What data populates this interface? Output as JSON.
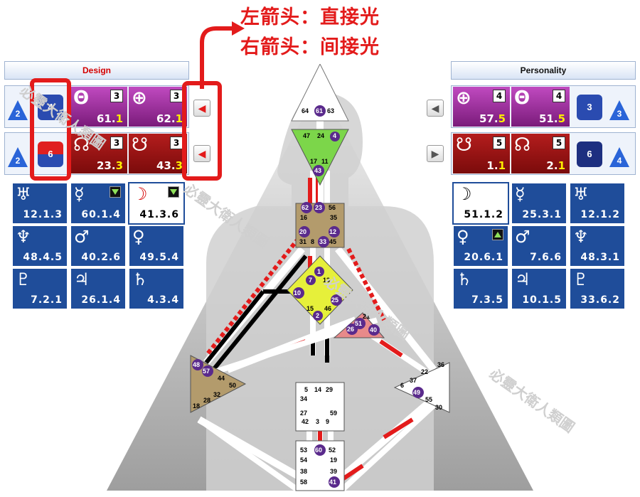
{
  "annotation": {
    "line1": "左箭头：直接光",
    "line2": "右箭头：间接光"
  },
  "design": {
    "header": "Design",
    "row1": {
      "hex_triangle": "2",
      "hex_octagon": "4",
      "planets": [
        {
          "glyph": "Θ",
          "box": "3",
          "value": "61.",
          "line": "1"
        },
        {
          "glyph": "⊕",
          "box": "3",
          "value": "62.",
          "line": "1"
        }
      ]
    },
    "row2": {
      "hex_triangle": "2",
      "hex_octagon": "6",
      "planets": [
        {
          "glyph": "☊",
          "box": "3",
          "value": "23.",
          "line": "3"
        },
        {
          "glyph": "☋",
          "box": "3",
          "value": "43.",
          "line": "3"
        }
      ]
    },
    "grid": [
      {
        "glyph": "♅",
        "value": "12.1.3"
      },
      {
        "glyph": "☿",
        "value": "60.1.4"
      },
      {
        "glyph": "☽",
        "value": "41.3.6"
      },
      {
        "glyph": "♆",
        "value": "48.4.5"
      },
      {
        "glyph": "♂",
        "value": "40.2.6"
      },
      {
        "glyph": "♀",
        "value": "49.5.4"
      },
      {
        "glyph": "♇",
        "value": "7.2.1"
      },
      {
        "glyph": "♃",
        "value": "26.1.4"
      },
      {
        "glyph": "♄",
        "value": "4.3.4"
      }
    ]
  },
  "personality": {
    "header": "Personality",
    "row1": {
      "planets": [
        {
          "glyph": "⊕",
          "box": "4",
          "value": "57.",
          "line": "5"
        },
        {
          "glyph": "Θ",
          "box": "4",
          "value": "51.",
          "line": "5"
        }
      ],
      "hex_octagon": "3",
      "hex_triangle": "3"
    },
    "row2": {
      "planets": [
        {
          "glyph": "☋",
          "box": "5",
          "value": "1.",
          "line": "1"
        },
        {
          "glyph": "☊",
          "box": "5",
          "value": "2.",
          "line": "1"
        }
      ],
      "hex_octagon": "6",
      "hex_triangle": "4"
    },
    "grid": [
      {
        "glyph": "☽",
        "value": "51.1.2"
      },
      {
        "glyph": "☿",
        "value": "25.3.1"
      },
      {
        "glyph": "♅",
        "value": "12.1.2"
      },
      {
        "glyph": "♀",
        "value": "20.6.1"
      },
      {
        "glyph": "♂",
        "value": "7.6.6"
      },
      {
        "glyph": "♆",
        "value": "48.3.1"
      },
      {
        "glyph": "♄",
        "value": "7.3.5"
      },
      {
        "glyph": "♃",
        "value": "10.1.5"
      },
      {
        "glyph": "♇",
        "value": "33.6.2"
      }
    ]
  },
  "watermark": "必靈大衛人類圖",
  "bodygraph": {
    "head": [
      "64",
      "61",
      "63"
    ],
    "ajna": [
      "47",
      "24",
      "4",
      "17",
      "11",
      "43"
    ],
    "throat": [
      "62",
      "23",
      "56",
      "16",
      "35",
      "20",
      "12",
      "31",
      "8",
      "33",
      "45"
    ],
    "g_center": [
      "1",
      "7",
      "13",
      "10",
      "25",
      "15",
      "46",
      "2"
    ],
    "heart": [
      "21",
      "51",
      "26",
      "40"
    ],
    "spleen": [
      "48",
      "57",
      "44",
      "50",
      "32",
      "28",
      "18"
    ],
    "sacral": [
      "5",
      "14",
      "29",
      "34",
      "27",
      "59",
      "42",
      "3",
      "9"
    ],
    "solar_plexus": [
      "36",
      "22",
      "37",
      "6",
      "49",
      "55",
      "30"
    ],
    "root": [
      "53",
      "60",
      "52",
      "54",
      "19",
      "38",
      "39",
      "58",
      "41"
    ]
  }
}
